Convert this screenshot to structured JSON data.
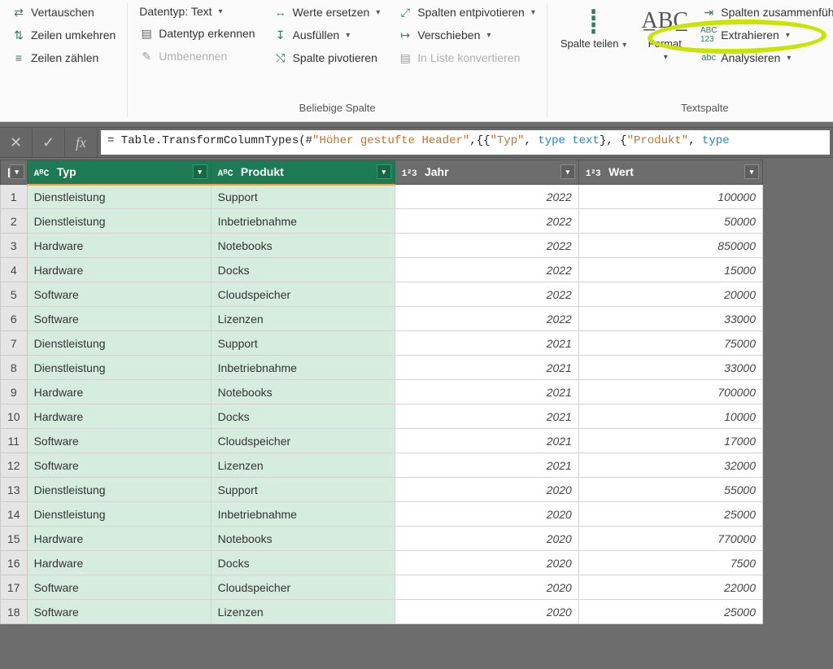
{
  "ribbon": {
    "group1": {
      "swap": "Vertauschen",
      "reverse_rows": "Zeilen umkehren",
      "count_rows": "Zeilen zählen"
    },
    "group2": {
      "datatype": "Datentyp: Text",
      "detect": "Datentyp erkennen",
      "rename": "Umbenennen",
      "replace": "Werte ersetzen",
      "fill": "Ausfüllen",
      "pivot": "Spalte pivotieren",
      "unpivot": "Spalten entpivotieren",
      "move": "Verschieben",
      "tolist": "In Liste konvertieren",
      "label": "Beliebige Spalte"
    },
    "group3": {
      "split": "Spalte teilen",
      "format": "Format",
      "merge": "Spalten zusammenführen",
      "extract": "Extrahieren",
      "analyze": "Analysieren",
      "label": "Textspalte"
    }
  },
  "formula": {
    "prefix": "= Table.TransformColumnTypes(#",
    "s1": "\"Höher gestufte Header\"",
    "mid1": ",{{",
    "s2": "\"Typ\"",
    "mid2": ", ",
    "t1": "type",
    "mid3": " ",
    "t2": "text",
    "mid4": "}, {",
    "s3": "\"Produkt\"",
    "mid5": ", ",
    "t3": "type"
  },
  "columns": {
    "c0_type": "AᴮC",
    "c0_name": "Typ",
    "c1_type": "AᴮC",
    "c1_name": "Produkt",
    "c2_type": "1²3",
    "c2_name": "Jahr",
    "c3_type": "1²3",
    "c3_name": "Wert"
  },
  "rows": [
    {
      "n": "1",
      "typ": "Dienstleistung",
      "prod": "Support",
      "jahr": "2022",
      "wert": "100000"
    },
    {
      "n": "2",
      "typ": "Dienstleistung",
      "prod": "Inbetriebnahme",
      "jahr": "2022",
      "wert": "50000"
    },
    {
      "n": "3",
      "typ": "Hardware",
      "prod": "Notebooks",
      "jahr": "2022",
      "wert": "850000"
    },
    {
      "n": "4",
      "typ": "Hardware",
      "prod": "Docks",
      "jahr": "2022",
      "wert": "15000"
    },
    {
      "n": "5",
      "typ": "Software",
      "prod": "Cloudspeicher",
      "jahr": "2022",
      "wert": "20000"
    },
    {
      "n": "6",
      "typ": "Software",
      "prod": "Lizenzen",
      "jahr": "2022",
      "wert": "33000"
    },
    {
      "n": "7",
      "typ": "Dienstleistung",
      "prod": "Support",
      "jahr": "2021",
      "wert": "75000"
    },
    {
      "n": "8",
      "typ": "Dienstleistung",
      "prod": "Inbetriebnahme",
      "jahr": "2021",
      "wert": "33000"
    },
    {
      "n": "9",
      "typ": "Hardware",
      "prod": "Notebooks",
      "jahr": "2021",
      "wert": "700000"
    },
    {
      "n": "10",
      "typ": "Hardware",
      "prod": "Docks",
      "jahr": "2021",
      "wert": "10000"
    },
    {
      "n": "11",
      "typ": "Software",
      "prod": "Cloudspeicher",
      "jahr": "2021",
      "wert": "17000"
    },
    {
      "n": "12",
      "typ": "Software",
      "prod": "Lizenzen",
      "jahr": "2021",
      "wert": "32000"
    },
    {
      "n": "13",
      "typ": "Dienstleistung",
      "prod": "Support",
      "jahr": "2020",
      "wert": "55000"
    },
    {
      "n": "14",
      "typ": "Dienstleistung",
      "prod": "Inbetriebnahme",
      "jahr": "2020",
      "wert": "25000"
    },
    {
      "n": "15",
      "typ": "Hardware",
      "prod": "Notebooks",
      "jahr": "2020",
      "wert": "770000"
    },
    {
      "n": "16",
      "typ": "Hardware",
      "prod": "Docks",
      "jahr": "2020",
      "wert": "7500"
    },
    {
      "n": "17",
      "typ": "Software",
      "prod": "Cloudspeicher",
      "jahr": "2020",
      "wert": "22000"
    },
    {
      "n": "18",
      "typ": "Software",
      "prod": "Lizenzen",
      "jahr": "2020",
      "wert": "25000"
    }
  ]
}
